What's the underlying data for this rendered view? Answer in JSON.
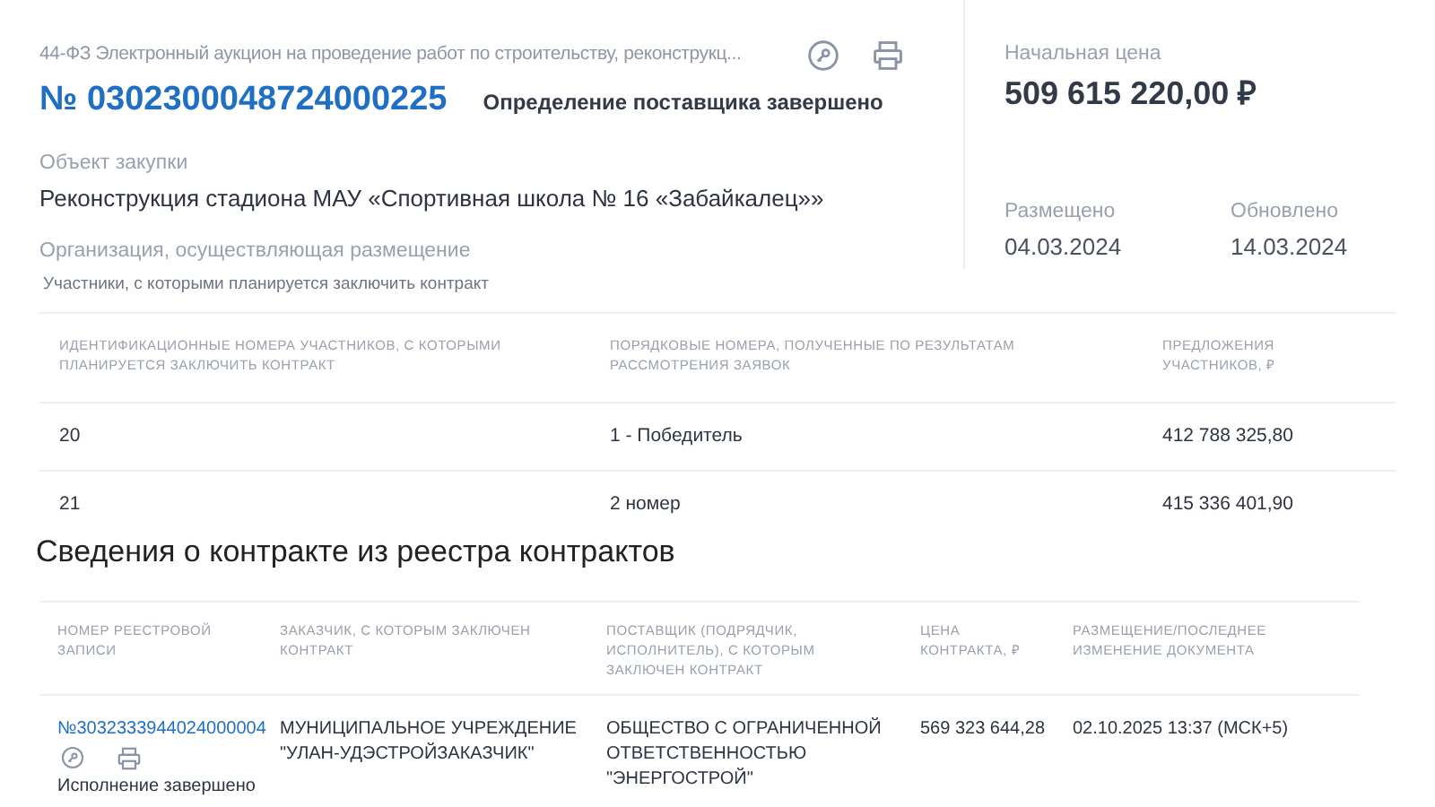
{
  "procurement": {
    "law_and_type": "44-ФЗ  Электронный аукцион на проведение работ по строительству, реконструкц...",
    "number": "№ 0302300048724000225",
    "status": "Определение поставщика завершено",
    "object_label": "Объект закупки",
    "object_value": "Реконструкция стадиона МАУ «Спортивная школа № 16 «Забайкалец»»",
    "organization_label": "Организация, осуществляющая размещение",
    "participants_label": "Участники, с которыми планируется заключить контракт"
  },
  "summary": {
    "price_label": "Начальная цена",
    "price": "509 615 220,00 ₽",
    "dates": [
      {
        "label": "Размещено",
        "value": "04.03.2024"
      },
      {
        "label": "Обновлено",
        "value": "14.03.2024"
      }
    ]
  },
  "participants_table": {
    "columns": [
      "ИДЕНТИФИКАЦИОННЫЕ НОМЕРА УЧАСТНИКОВ, С КОТОРЫМИ ПЛАНИРУЕТСЯ ЗАКЛЮЧИТЬ КОНТРАКТ",
      "ПОРЯДКОВЫЕ НОМЕРА, ПОЛУЧЕННЫЕ ПО РЕЗУЛЬТАТАМ РАССМОТРЕНИЯ ЗАЯВОК",
      "ПРЕДЛОЖЕНИЯ УЧАСТНИКОВ, ₽"
    ],
    "rows": [
      [
        "20",
        "1 - Победитель",
        "412 788 325,80"
      ],
      [
        "21",
        "2 номер",
        "415 336 401,90"
      ]
    ]
  },
  "contracts": {
    "title": "Сведения о контракте из реестра контрактов",
    "columns": [
      "НОМЕР РЕЕСТРОВОЙ ЗАПИСИ",
      "ЗАКАЗЧИК, С КОТОРЫМ ЗАКЛЮЧЕН КОНТРАКТ",
      "ПОСТАВЩИК (ПОДРЯДЧИК, ИСПОЛНИТЕЛЬ), С КОТОРЫМ ЗАКЛЮЧЕН КОНТРАКТ",
      "ЦЕНА КОНТРАКТА, ₽",
      "РАЗМЕЩЕНИЕ/ПОСЛЕДНЕЕ ИЗМЕНЕНИЕ ДОКУМЕНТА"
    ],
    "rows": [
      {
        "number": "№3032333944024000004",
        "status": "Исполнение завершено",
        "customer": "МУНИЦИПАЛЬНОЕ УЧРЕЖДЕНИЕ \"УЛАН-УДЭСТРОЙЗАКАЗЧИК\"",
        "supplier": "ОБЩЕСТВО С ОГРАНИЧЕННОЙ ОТВЕТСТВЕННОСТЬЮ \"ЭНЕРГОСТРОЙ\"",
        "price": "569 323 644,28",
        "date": "02.10.2025 13:37 (МСК+5)"
      }
    ]
  }
}
